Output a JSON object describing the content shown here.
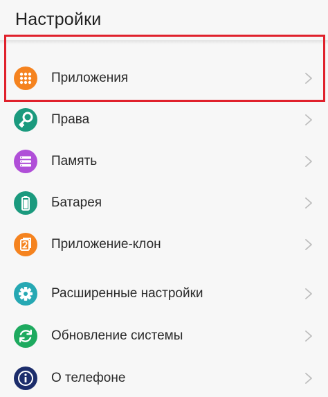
{
  "header": {
    "title": "Настройки"
  },
  "items": [
    {
      "label": "Приложения",
      "icon": "apps-grid-icon",
      "color": "#f5831f"
    },
    {
      "label": "Права",
      "icon": "key-icon",
      "color": "#1b9a7e"
    },
    {
      "label": "Память",
      "icon": "storage-icon",
      "color": "#b04fd8"
    },
    {
      "label": "Батарея",
      "icon": "battery-icon",
      "color": "#1b9a7e"
    },
    {
      "label": "Приложение-клон",
      "icon": "app-twin-icon",
      "color": "#f5831f"
    },
    {
      "label": "Расширенные настройки",
      "icon": "gear-icon",
      "color": "#26a8b3"
    },
    {
      "label": "Обновление системы",
      "icon": "system-update-icon",
      "color": "#1eaa5f"
    },
    {
      "label": "О телефоне",
      "icon": "info-icon",
      "color": "#1c2d6b"
    }
  ],
  "highlight_color": "#e0212c"
}
